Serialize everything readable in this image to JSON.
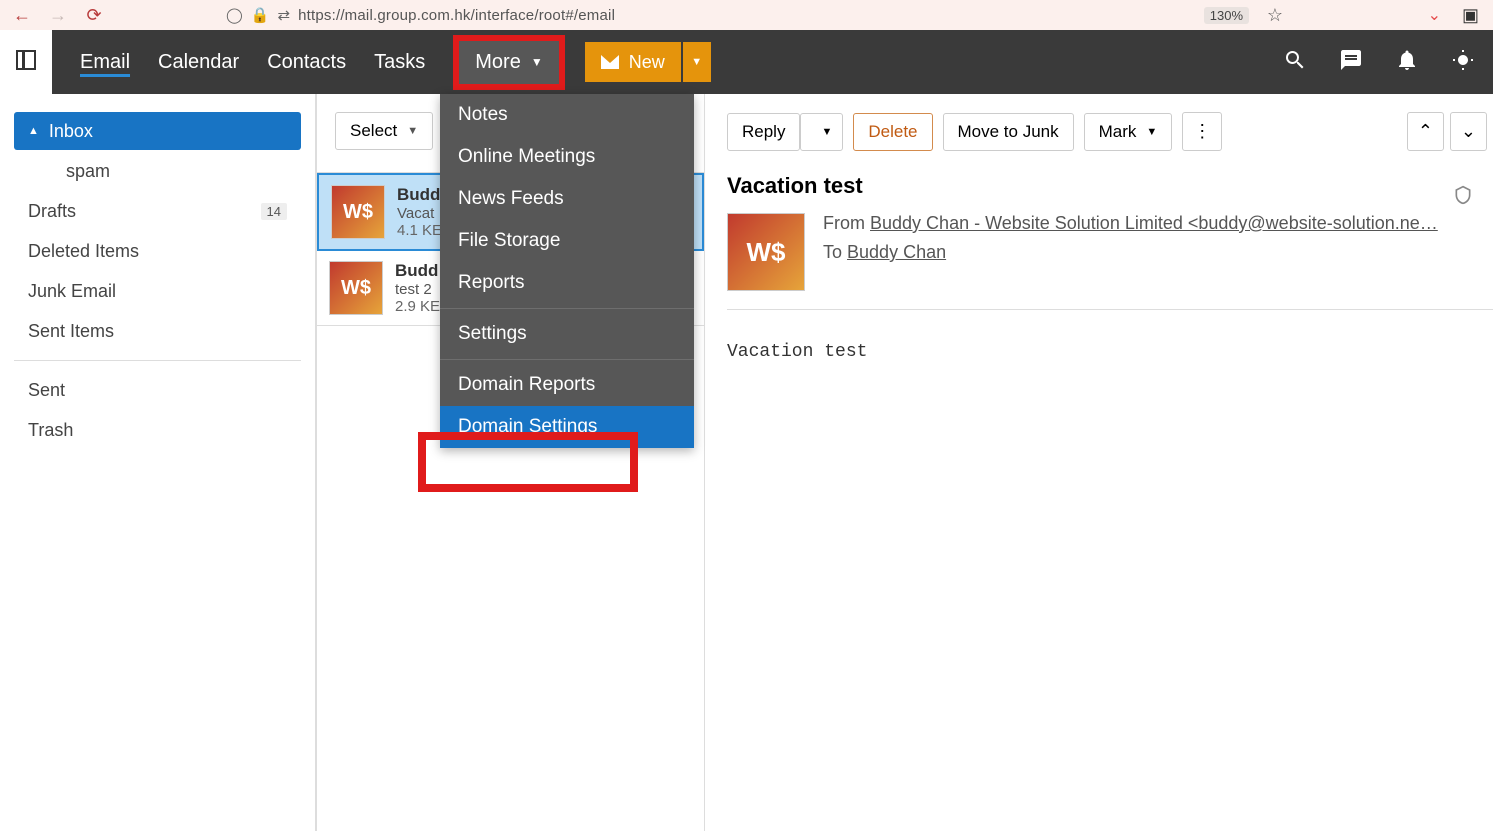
{
  "browser": {
    "url": "https://mail.group.com.hk/interface/root#/email",
    "zoom": "130%"
  },
  "header": {
    "nav": {
      "email": "Email",
      "calendar": "Calendar",
      "contacts": "Contacts",
      "tasks": "Tasks",
      "more": "More"
    },
    "new_label": "New"
  },
  "more_menu": {
    "notes": "Notes",
    "online_meetings": "Online Meetings",
    "news_feeds": "News Feeds",
    "file_storage": "File Storage",
    "reports": "Reports",
    "settings": "Settings",
    "domain_reports": "Domain Reports",
    "domain_settings": "Domain Settings"
  },
  "sidebar": {
    "inbox": "Inbox",
    "spam": "spam",
    "drafts": "Drafts",
    "drafts_count": "14",
    "deleted": "Deleted Items",
    "junk": "Junk Email",
    "sentitems": "Sent Items",
    "sent": "Sent",
    "trash": "Trash"
  },
  "list": {
    "select": "Select",
    "items": [
      {
        "from": "Budd",
        "subj": "Vacat",
        "size": "4.1 KE"
      },
      {
        "from": "Budd",
        "subj": "test 2",
        "size": "2.9 KE"
      }
    ]
  },
  "reader": {
    "reply": "Reply",
    "delete": "Delete",
    "move_junk": "Move to Junk",
    "mark": "Mark",
    "subject": "Vacation test",
    "from_label": "From",
    "from_value": "Buddy Chan - Website Solution Limited  <buddy@website-solution.ne…",
    "to_label": "To",
    "to_value": "Buddy Chan",
    "body": "Vacation test"
  }
}
